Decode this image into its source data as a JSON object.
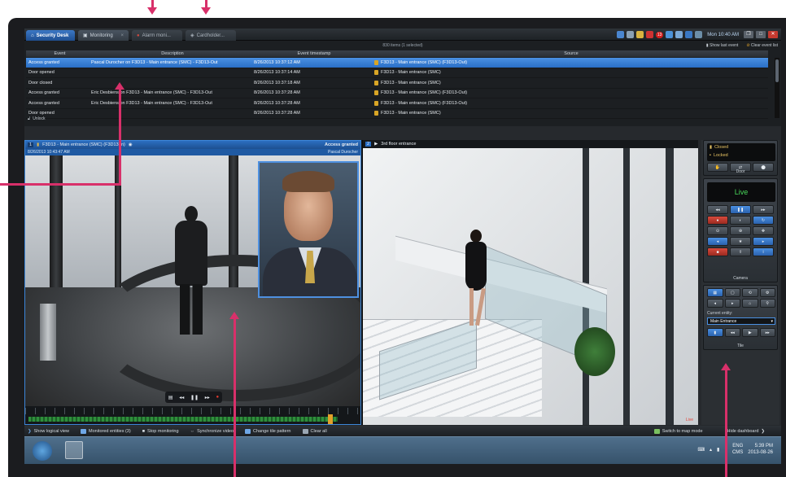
{
  "app": {
    "tabs": [
      {
        "label": "Security Desk"
      },
      {
        "label": "Monitoring"
      },
      {
        "label": "Alarm moni..."
      },
      {
        "label": "Cardholder..."
      }
    ],
    "notification_count": "13",
    "clock": "Mon 10:40 AM"
  },
  "events": {
    "item_count": "830 items (1 selected)",
    "show_last_event": "Show last event",
    "clear_event_list": "Clear event list",
    "columns": [
      "Event",
      "Description",
      "Event timestamp",
      "Source"
    ],
    "rows": [
      {
        "event": "Access granted",
        "description": "Pascal Durocher on F3D13 - Main entrance (SMC) - F3D13-Out",
        "timestamp": "8/26/2013 10:37:12 AM",
        "source": "F3D13 - Main entrance (SMC) (F3D13-Out)"
      },
      {
        "event": "Door opened",
        "description": "",
        "timestamp": "8/26/2013 10:37:14 AM",
        "source": "F3D13 - Main entrance (SMC)"
      },
      {
        "event": "Door closed",
        "description": "",
        "timestamp": "8/26/2013 10:37:18 AM",
        "source": "F3D13 - Main entrance (SMC)"
      },
      {
        "event": "Access granted",
        "description": "Eric Desbiens on F3D13 - Main entrance (SMC) - F3D13-Out",
        "timestamp": "8/26/2013 10:37:28 AM",
        "source": "F3D13 - Main entrance (SMC) (F3D13-Out)"
      },
      {
        "event": "Access granted",
        "description": "Eric Desbiens on F3D13 - Main entrance (SMC) - F3D13-Out",
        "timestamp": "8/26/2013 10:37:28 AM",
        "source": "F3D13 - Main entrance (SMC) (F3D13-Out)"
      },
      {
        "event": "Door opened",
        "description": "",
        "timestamp": "8/26/2013 10:37:28 AM",
        "source": "F3D13 - Main entrance (SMC)"
      }
    ],
    "unlock_label": "Unlock"
  },
  "tiles": {
    "tile1": {
      "number": "1",
      "title": "F3D13 - Main entrance (SMC) (F3D13-In)",
      "status": "Access granted",
      "datetime": "8/26/2013 10:43:47 AM",
      "person": "Pascal Durocher"
    },
    "tile2": {
      "number": "2",
      "title": "3rd floor entrance",
      "live": "Live"
    }
  },
  "dashboard": {
    "door": {
      "closed": "Closed",
      "locked": "Locked",
      "title": "Door"
    },
    "camera": {
      "live": "Live",
      "title": "Camera"
    },
    "tile": {
      "current_entity_label": "Current entity:",
      "current_entity": "Main Entrance",
      "title": "Tile"
    }
  },
  "commands": {
    "left": [
      "Show logical view",
      "Monitored entities (3)",
      "Stop monitoring",
      "Synchronize video",
      "Change tile pattern",
      "Clear all"
    ],
    "right": [
      "Switch to map mode",
      "Hide dashboard"
    ]
  },
  "taskbar": {
    "lang": "ENG",
    "lang2": "CMS",
    "time": "5:39 PM",
    "date": "2013-08-26"
  },
  "colors": {
    "accent": "#2a6fc6",
    "live_green": "#49d85a",
    "annotation": "#d8306a"
  }
}
